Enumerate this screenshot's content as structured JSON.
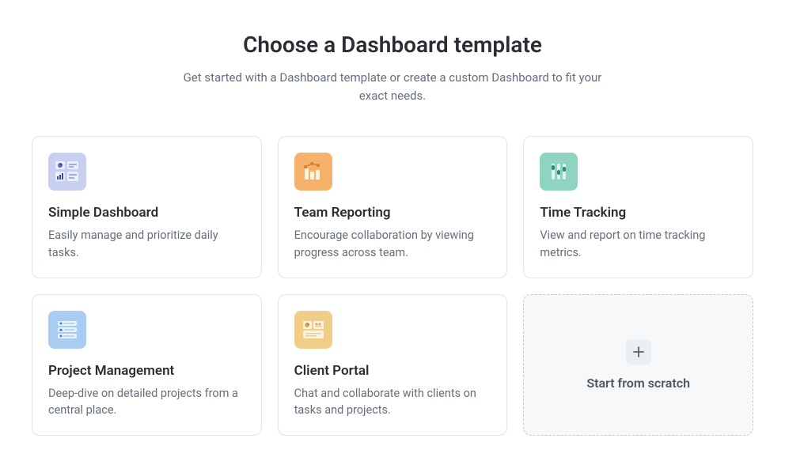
{
  "header": {
    "title": "Choose a Dashboard template",
    "subtitle": "Get started with a Dashboard template or create a custom Dashboard to fit your exact needs."
  },
  "templates": [
    {
      "icon": "simple-dashboard-icon",
      "title": "Simple Dashboard",
      "desc": "Easily manage and prioritize daily tasks."
    },
    {
      "icon": "team-reporting-icon",
      "title": "Team Reporting",
      "desc": "Encourage collaboration by viewing progress across team."
    },
    {
      "icon": "time-tracking-icon",
      "title": "Time Tracking",
      "desc": "View and report on time tracking metrics."
    },
    {
      "icon": "project-management-icon",
      "title": "Project Management",
      "desc": "Deep-dive on detailed projects from a central place."
    },
    {
      "icon": "client-portal-icon",
      "title": "Client Portal",
      "desc": "Chat and collaborate with clients on tasks and projects."
    }
  ],
  "scratch": {
    "label": "Start from scratch"
  }
}
